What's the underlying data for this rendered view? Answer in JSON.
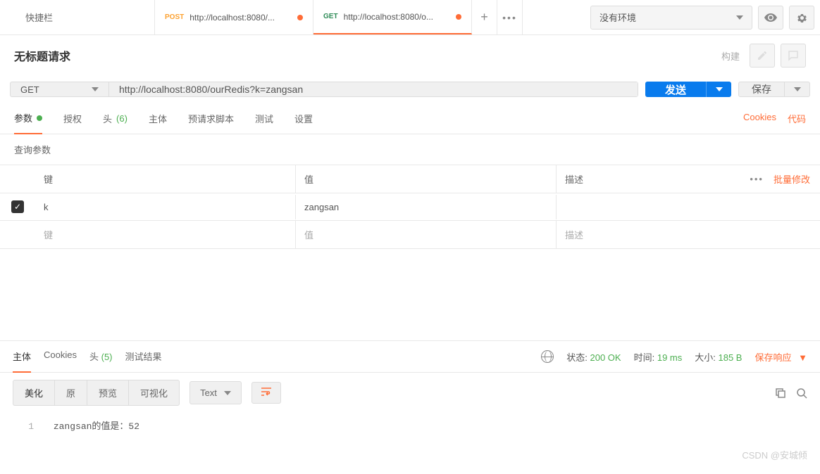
{
  "topbar": {
    "quick_tab": "快捷栏",
    "tabs": [
      {
        "method": "POST",
        "url": "http://localhost:8080/..."
      },
      {
        "method": "GET",
        "url": "http://localhost:8080/o..."
      }
    ],
    "env_selector": "没有环境"
  },
  "title": {
    "text": "无标题请求",
    "build": "构建"
  },
  "request": {
    "method": "GET",
    "url": "http://localhost:8080/ourRedis?k=zangsan",
    "send": "发送",
    "save": "保存"
  },
  "req_tabs": {
    "params": "参数",
    "auth": "授权",
    "headers": "头",
    "headers_count": "(6)",
    "body": "主体",
    "prerequest": "预请求脚本",
    "tests": "测试",
    "settings": "设置",
    "cookies": "Cookies",
    "code": "代码"
  },
  "params": {
    "section_label": "查询参数",
    "header_key": "键",
    "header_value": "值",
    "header_desc": "描述",
    "bulk_edit": "批量修改",
    "rows": [
      {
        "key": "k",
        "value": "zangsan",
        "desc": ""
      }
    ],
    "placeholder_key": "键",
    "placeholder_value": "值",
    "placeholder_desc": "描述"
  },
  "response": {
    "tabs": {
      "body": "主体",
      "cookies": "Cookies",
      "headers": "头",
      "headers_count": "(5)",
      "tests": "测试结果"
    },
    "status_label": "状态:",
    "status_value": "200 OK",
    "time_label": "时间:",
    "time_value": "19 ms",
    "size_label": "大小:",
    "size_value": "185 B",
    "save_response": "保存响应",
    "view_tabs": {
      "pretty": "美化",
      "raw": "原",
      "preview": "预览",
      "visualize": "可视化"
    },
    "format": "Text",
    "body_text": "zangsan的值是：52"
  },
  "watermark": "CSDN @安城倾"
}
